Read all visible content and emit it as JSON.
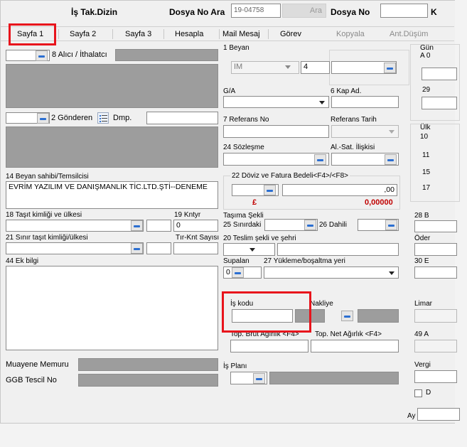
{
  "header": {
    "is_takip_dizini": "İş Tak.Dizin",
    "dosya_no_ara_label": "Dosya No Ara",
    "dosya_no_value": "19-04758",
    "ara_button": "Ara",
    "dosya_no_label": "Dosya No",
    "k_label": "K"
  },
  "tabs": [
    {
      "label": "Sayfa 1"
    },
    {
      "label": "Sayfa 2"
    },
    {
      "label": "Sayfa 3"
    },
    {
      "label": "Hesapla"
    },
    {
      "label": "Mail Mesaj"
    },
    {
      "label": "Görev"
    },
    {
      "label": "Kopyala"
    },
    {
      "label": "Ant.Düşüm"
    }
  ],
  "left": {
    "alici_label": "8 Alıcı / İthalatcı",
    "gonderen_label": "2 Gönderen",
    "dmp_label": "Dmp.",
    "beyan_sahibi_label": "14 Beyan sahibi/Temsilcisi",
    "beyan_sahibi_text": "EVRİM YAZILIM VE DANIŞMANLIK TİC.LTD.ŞTİ--DENEME",
    "tasit_label": "18 Taşıt kimliği ve ülkesi",
    "kntyr_label": "19 Kntyr",
    "kntyr_value": "0",
    "sinir_label": "21 Sınır taşıt kimliği/ülkesi",
    "trknt_label": "Tır-Knt Sayısı",
    "ek_bilgi_label": "44 Ek bilgi",
    "muayene_label": "Muayene Memuru",
    "ggb_label": "GGB Tescil No"
  },
  "middle": {
    "beyan_label": "1 Beyan",
    "beyan_select": "IM",
    "beyan_num": "4",
    "ga_label": "G/A",
    "kap_label": "6 Kap Ad.",
    "referans_label": "7 Referans No",
    "referans_tarih_label": "Referans Tarih",
    "sozlesme_label": "24 Sözleşme",
    "alsat_label": "Al.-Sat. İlişkisi",
    "doviz_label": "22 Döviz ve Fatura Bedeli<F4>/<F8>",
    "doviz_value": ",00",
    "currency_symbol": "£",
    "total_value": "0,00000",
    "tasima_label": "Taşıma Şekli",
    "sinirdaki_label": "25 Sınırdaki",
    "dahili_label": "26 Dahili",
    "teslim_label": "20 Teslim şekli ve şehri",
    "supalan_label": "Supalan",
    "supalan_value": "0",
    "yukleme_label": "27 Yükleme/boşaltma yeri",
    "is_kodu_label": "İş kodu",
    "nakliye_label": "Nakliye",
    "brut_label": "Top. Brut Ağırlık <F4>",
    "net_label": "Top. Net Ağırlık <F4>",
    "is_plani_label": "İş Planı"
  },
  "right": {
    "gun_label": "Gün",
    "a0_label": "A 0",
    "n29_label": "29",
    "ulk_label": "Ülk",
    "n10_label": "10",
    "n11_label": "11",
    "n15_label": "15",
    "n17_label": "17",
    "n28_label": "28 B",
    "oder_label": "Öder",
    "n30_label": "30 E",
    "limar_label": "Limar",
    "n49_label": "49 A",
    "vergi_label": "Vergi",
    "d_label": "D",
    "ay_label": "Ay"
  },
  "colors": {
    "highlight_red": "#e8141c",
    "value_red": "#c00000"
  }
}
